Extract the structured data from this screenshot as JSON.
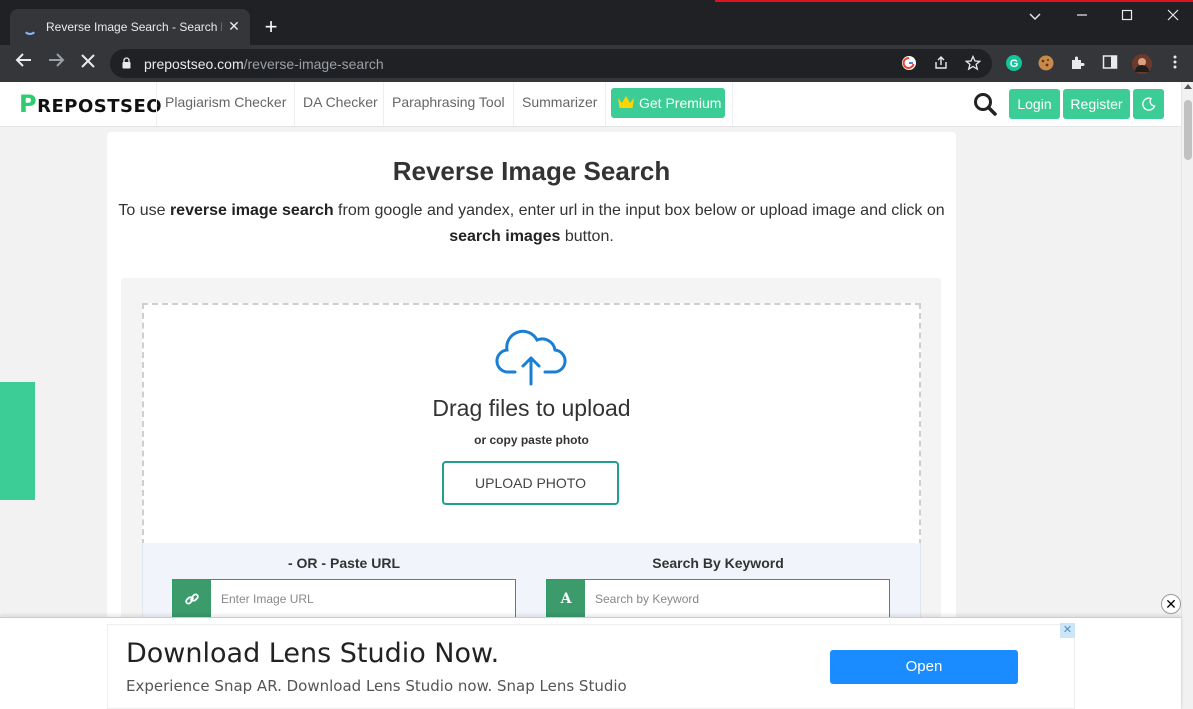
{
  "browser": {
    "tab_title": "Reverse Image Search - Search By",
    "tab_close": "✕",
    "new_tab": "+",
    "url_domain": "prepostseo.com",
    "url_path": "/reverse-image-search"
  },
  "site": {
    "logo_mark": "P",
    "logo_text": "REPOSTSEO",
    "nav": [
      {
        "label": "Plagiarism Checker"
      },
      {
        "label": "DA Checker"
      },
      {
        "label": "Paraphrasing Tool"
      },
      {
        "label": "Summarizer"
      }
    ],
    "premium_label": "Get Premium",
    "login_label": "Login",
    "register_label": "Register"
  },
  "page": {
    "title": "Reverse Image Search",
    "intro_pre": "To use ",
    "intro_b1": "reverse image search",
    "intro_mid": " from google and yandex, enter url in the input box below or upload image and click on ",
    "intro_b2": "search images",
    "intro_post": " button."
  },
  "upload": {
    "drag_title": "Drag files to upload",
    "drag_sub": "or copy paste photo",
    "button_label": "UPLOAD PHOTO"
  },
  "url_search": {
    "label": "- OR - Paste URL",
    "placeholder": "Enter Image URL"
  },
  "keyword_search": {
    "label": "Search By Keyword",
    "placeholder": "Search by Keyword",
    "addon": "A"
  },
  "float_close": "✕",
  "ad": {
    "title": "Download Lens Studio Now.",
    "subtitle": "Experience Snap AR. Download Lens Studio now. Snap Lens Studio",
    "button_label": "Open",
    "close": "✕"
  },
  "colors": {
    "accent_green": "#3ccd97",
    "ad_blue": "#1a8cff",
    "browser_dark": "#202124"
  }
}
